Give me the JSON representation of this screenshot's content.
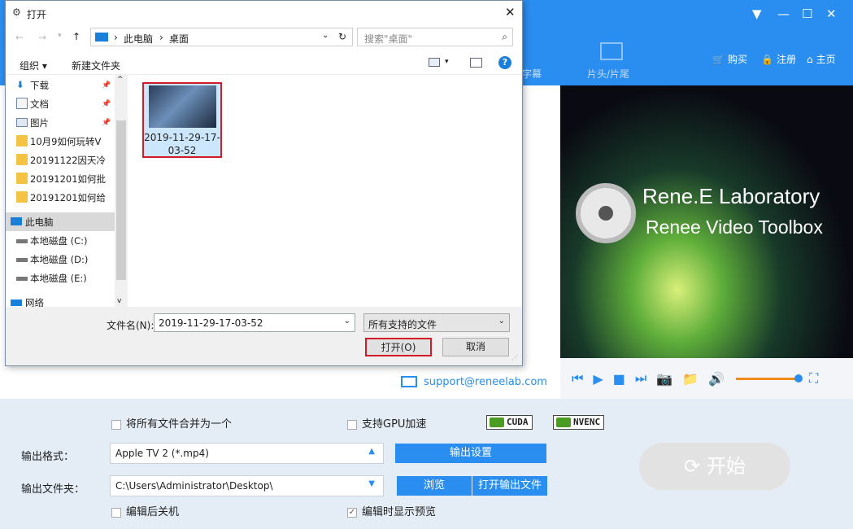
{
  "app": {
    "nav": {
      "subtitle": "字幕",
      "head_tail": "片头/片尾",
      "buy": "购买",
      "register": "注册",
      "home": "主页"
    },
    "video": {
      "title1": "Rene.E Laboratory",
      "title2": "Renee Video Toolbox"
    },
    "support": "support@reneelab.com",
    "options": {
      "merge": "将所有文件合并为一个",
      "gpu": "支持GPU加速",
      "cuda": "CUDA",
      "nvenc": "NVENC",
      "shutdown": "编辑后关机",
      "preview": "编辑时显示预览"
    },
    "output_format_label": "输出格式：",
    "output_format_value": "Apple TV 2 (*.mp4)",
    "output_settings": "输出设置",
    "output_folder_label": "输出文件夹：",
    "output_folder_value": "C:\\Users\\Administrator\\Desktop\\",
    "browse": "浏览",
    "open_output": "打开输出文件",
    "start": "开始"
  },
  "dialog": {
    "title": "打开",
    "path": [
      "此电脑",
      "桌面"
    ],
    "search_placeholder": "搜索\"桌面\"",
    "organize": "组织 ▾",
    "new_folder": "新建文件夹",
    "nav": [
      {
        "label": "下载"
      },
      {
        "label": "文档"
      },
      {
        "label": "图片"
      },
      {
        "label": "10月9如何玩转V"
      },
      {
        "label": "20191122因天冷"
      },
      {
        "label": "20191201如何批"
      },
      {
        "label": "20191201如何给"
      },
      {
        "label": "此电脑"
      },
      {
        "label": "本地磁盘 (C:)"
      },
      {
        "label": "本地磁盘 (D:)"
      },
      {
        "label": "本地磁盘 (E:)"
      },
      {
        "label": "网络"
      }
    ],
    "file_name": "2019-11-29-17-03-52",
    "file_label_line1": "2019-11-29-17-",
    "file_label_line2": "03-52",
    "filename_label": "文件名(N):",
    "filetype": "所有支持的文件",
    "open_btn": "打开(O)",
    "cancel_btn": "取消"
  }
}
